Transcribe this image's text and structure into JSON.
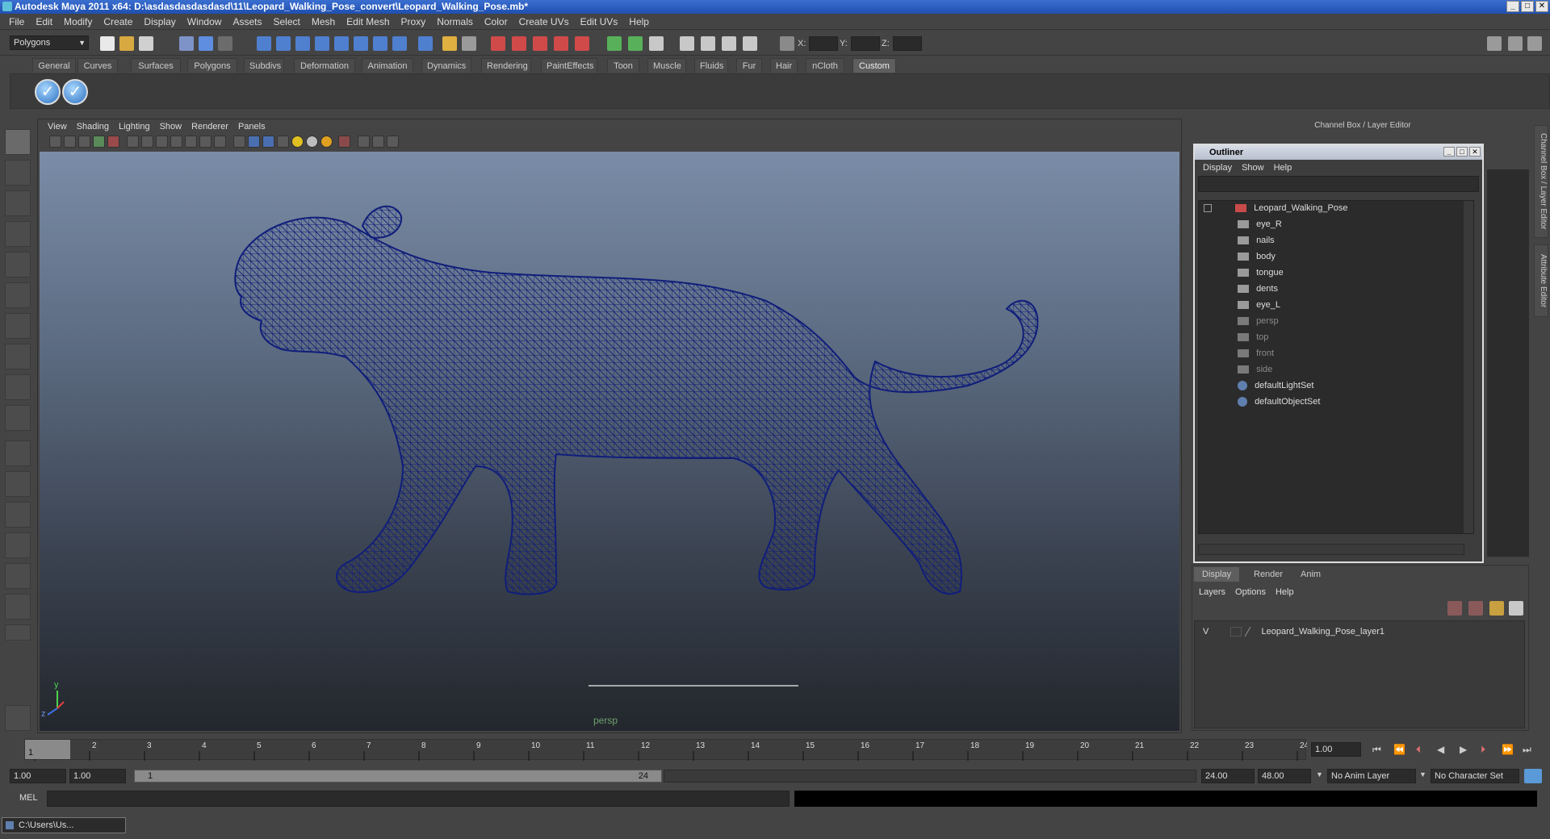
{
  "window": {
    "title": "Autodesk Maya 2011 x64: D:\\asdasdasdasdasd\\11\\Leopard_Walking_Pose_convert\\Leopard_Walking_Pose.mb*",
    "min": "_",
    "max": "□",
    "close": "✕"
  },
  "menu": [
    "File",
    "Edit",
    "Modify",
    "Create",
    "Display",
    "Window",
    "Assets",
    "Select",
    "Mesh",
    "Edit Mesh",
    "Proxy",
    "Normals",
    "Color",
    "Create UVs",
    "Edit UVs",
    "Help"
  ],
  "status": {
    "mode": "Polygons",
    "x": "X:",
    "y": "Y:",
    "z": "Z:"
  },
  "shelf_tabs": [
    "General",
    "Curves",
    "Surfaces",
    "Polygons",
    "Subdivs",
    "Deformation",
    "Animation",
    "Dynamics",
    "Rendering",
    "PaintEffects",
    "Toon",
    "Muscle",
    "Fluids",
    "Fur",
    "Hair",
    "nCloth",
    "Custom"
  ],
  "shelf_active": "Custom",
  "viewport": {
    "menu": [
      "View",
      "Shading",
      "Lighting",
      "Show",
      "Renderer",
      "Panels"
    ],
    "camera": "persp",
    "axis_y": "y",
    "axis_z": "z"
  },
  "channel_box": {
    "header": "Channel Box / Layer Editor",
    "vtab1": "Channel Box / Layer Editor",
    "vtab2": "Attribute Editor"
  },
  "outliner": {
    "title": "Outliner",
    "menu": [
      "Display",
      "Show",
      "Help"
    ],
    "root": "Leopard_Walking_Pose",
    "children": [
      "eye_R",
      "nails",
      "body",
      "tongue",
      "dents",
      "eye_L"
    ],
    "cameras": [
      "persp",
      "top",
      "front",
      "side"
    ],
    "sets": [
      "defaultLightSet",
      "defaultObjectSet"
    ]
  },
  "layer_editor": {
    "tabs": [
      "Display",
      "Render",
      "Anim"
    ],
    "menu": [
      "Layers",
      "Options",
      "Help"
    ],
    "layer": {
      "visible": "V",
      "name": "Leopard_Walking_Pose_layer1"
    }
  },
  "timeline": {
    "ticks": [
      "1",
      "2",
      "3",
      "4",
      "5",
      "6",
      "7",
      "8",
      "9",
      "10",
      "11",
      "12",
      "13",
      "14",
      "15",
      "16",
      "17",
      "18",
      "19",
      "20",
      "21",
      "22",
      "23",
      "24"
    ],
    "current_marker": "1",
    "current": "1.00"
  },
  "range": {
    "start": "1.00",
    "anim_start": "1.00",
    "bar_start": "1",
    "bar_end": "24",
    "anim_end": "24.00",
    "end": "48.00",
    "anim_layer": "No Anim Layer",
    "char_set": "No Character Set"
  },
  "cmd": {
    "label": "MEL"
  },
  "minimized": {
    "label": "C:\\Users\\Us..."
  },
  "colors": {
    "wire": "#101e7a",
    "title_blue": "#2a5cc0",
    "accent": "#5ec0d8"
  }
}
